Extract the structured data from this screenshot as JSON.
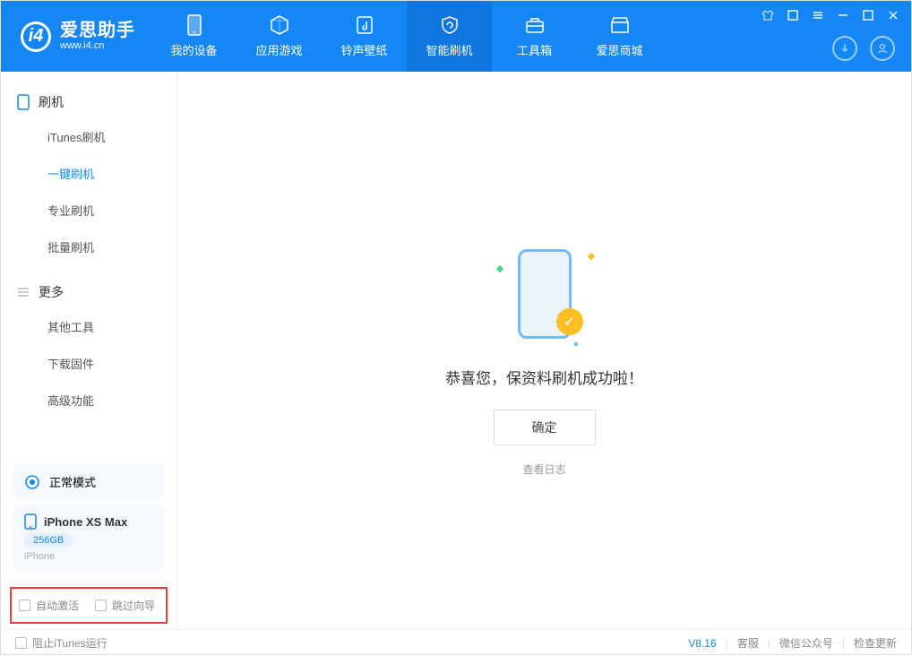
{
  "app": {
    "title": "爱思助手",
    "subtitle": "www.i4.cn"
  },
  "nav": {
    "tabs": [
      {
        "label": "我的设备"
      },
      {
        "label": "应用游戏"
      },
      {
        "label": "铃声壁纸"
      },
      {
        "label": "智能刷机"
      },
      {
        "label": "工具箱"
      },
      {
        "label": "爱思商城"
      }
    ]
  },
  "sidebar": {
    "group1_title": "刷机",
    "group1_items": [
      {
        "label": "iTunes刷机"
      },
      {
        "label": "一键刷机"
      },
      {
        "label": "专业刷机"
      },
      {
        "label": "批量刷机"
      }
    ],
    "group2_title": "更多",
    "group2_items": [
      {
        "label": "其他工具"
      },
      {
        "label": "下载固件"
      },
      {
        "label": "高级功能"
      }
    ],
    "mode_label": "正常模式",
    "device_name": "iPhone XS Max",
    "device_storage": "256GB",
    "device_type": "iPhone",
    "cb_auto_activate": "自动激活",
    "cb_skip_guide": "跳过向导"
  },
  "main": {
    "success_text": "恭喜您，保资料刷机成功啦！",
    "confirm_btn": "确定",
    "view_log": "查看日志"
  },
  "footer": {
    "block_itunes": "阻止iTunes运行",
    "version": "V8.16",
    "links": [
      "客服",
      "微信公众号",
      "检查更新"
    ]
  }
}
